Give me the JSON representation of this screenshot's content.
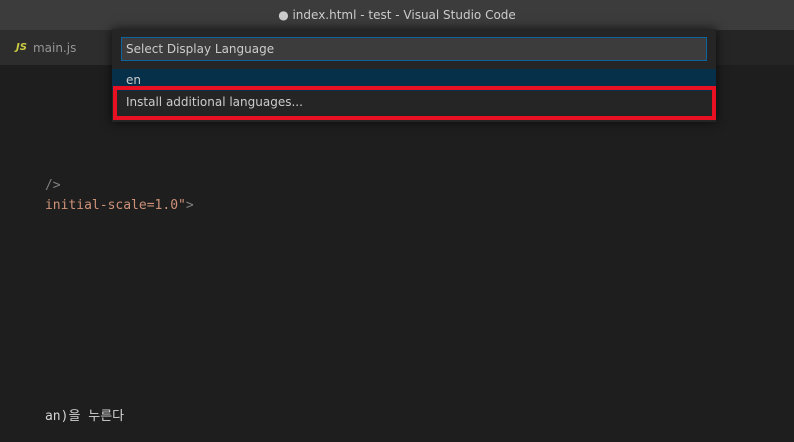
{
  "window": {
    "title": "● index.html - test - Visual Studio Code"
  },
  "tabs": [
    {
      "icon": "JS",
      "label": "main.js"
    }
  ],
  "editor": {
    "lines": [
      {
        "text": "/>"
      },
      {
        "string": "initial-scale=1.0\"",
        "punct": ">"
      },
      {
        "text": "an)을 누른다"
      }
    ]
  },
  "quick_pick": {
    "placeholder": "Select Display Language",
    "items": [
      {
        "label": "en"
      },
      {
        "label": "Install additional languages..."
      }
    ]
  },
  "colors": {
    "highlight": "#e81123",
    "selection": "#062f4a",
    "input_border": "#0e639c"
  }
}
